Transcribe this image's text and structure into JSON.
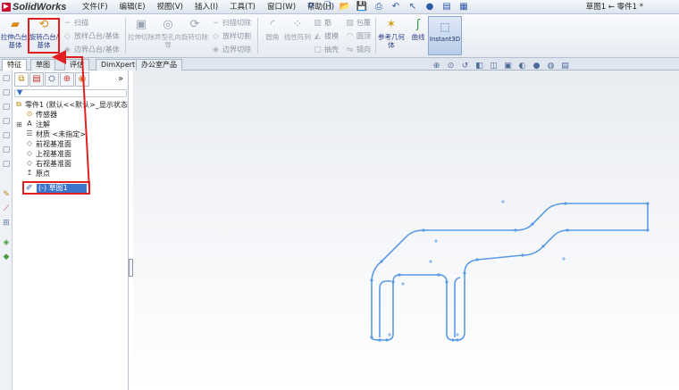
{
  "app": {
    "name": "SolidWorks",
    "document_title": "草图1 ← 零件1 *"
  },
  "menu": [
    "文件(F)",
    "编辑(E)",
    "视图(V)",
    "插入(I)",
    "工具(T)",
    "窗口(W)",
    "帮助(H)"
  ],
  "commands": {
    "extrude_boss": "拉伸凸台/基体",
    "revolve_boss": "旋转凸台/基体",
    "sweep": "扫描",
    "loft": "放样凸台/基体",
    "boundary_boss": "边界凸台/基体",
    "extrude_cut": "拉伸切除",
    "hole_wizard": "异型孔向导",
    "revolve_cut": "旋转切除",
    "swept_cut": "扫描切除",
    "lofted_cut": "放样切割",
    "boundary_cut": "边界切除",
    "fillet": "圆角",
    "linear_pattern": "线性阵列",
    "rib": "筋",
    "draft": "拔模",
    "shell": "抽壳",
    "wrap": "包覆",
    "intersect": "圆顶",
    "mirror": "镜向",
    "ref_geometry": "参考几何体",
    "curves": "曲线",
    "instant3d": "Instant3D"
  },
  "tabs": [
    "特征",
    "草图",
    "评估",
    "DimXpert",
    "办公室产品"
  ],
  "feature_tree": {
    "root": "零件1  (默认<<默认>_显示状态",
    "items": [
      "传感器",
      "注解",
      "材质 <未指定>",
      "前视基准面",
      "上视基准面",
      "右视基准面",
      "原点"
    ],
    "selected": "(-) 草图1"
  },
  "colors": {
    "sketch_line": "#5b9be6",
    "annotation": "#e02020",
    "selection": "#3c75cc"
  }
}
